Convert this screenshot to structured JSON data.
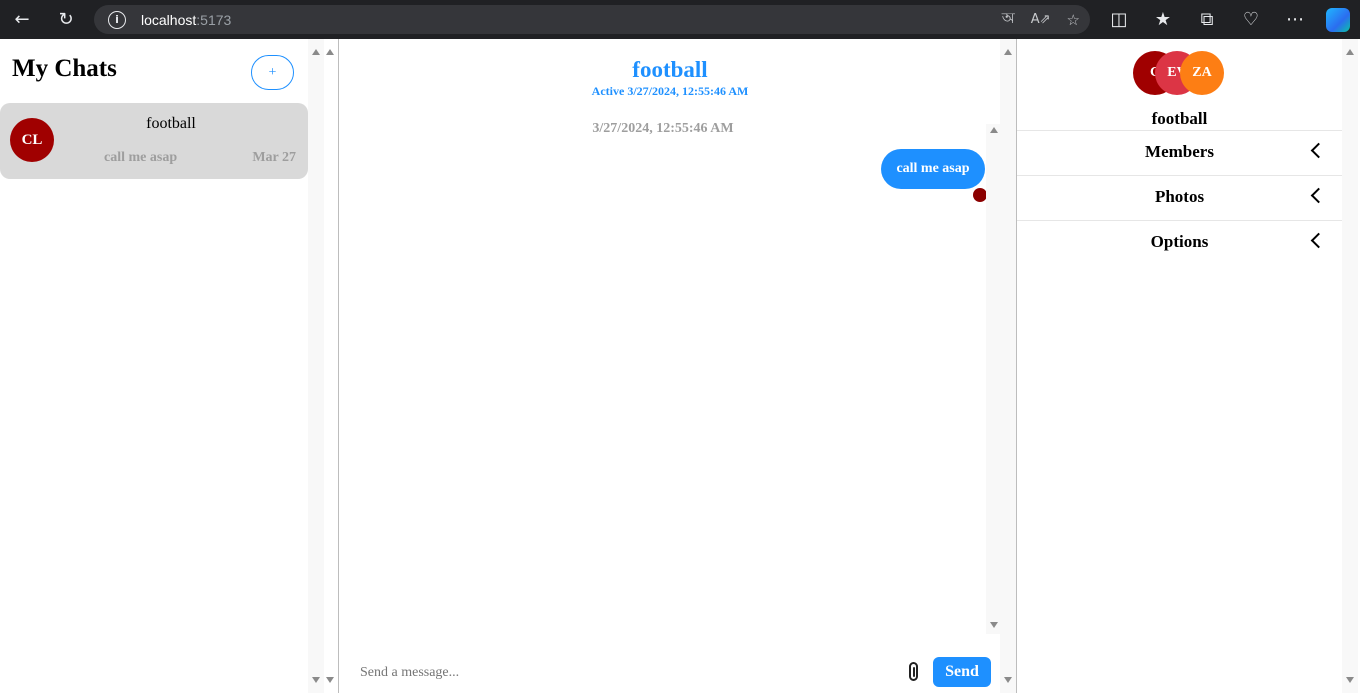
{
  "browser": {
    "url_host": "localhost",
    "url_port": ":5173"
  },
  "sidebar": {
    "title": "My Chats",
    "new_chat_label": "+",
    "chats": [
      {
        "initials": "CL",
        "name": "football",
        "preview": "call me asap",
        "date": "Mar 27",
        "avatar_color": "#a00000"
      }
    ]
  },
  "chat": {
    "title": "football",
    "status": "Active 3/27/2024, 12:55:46 AM",
    "messages": [
      {
        "timestamp": "3/27/2024, 12:55:46 AM",
        "text": "call me asap"
      }
    ],
    "input_placeholder": "Send a message...",
    "send_label": "Send"
  },
  "details": {
    "members": [
      {
        "initials": "C",
        "color": "#a00000"
      },
      {
        "initials": "EV",
        "color": "#dc3545"
      },
      {
        "initials": "ZA",
        "color": "#fd7e14"
      }
    ],
    "group_name": "football",
    "sections": [
      "Members",
      "Photos",
      "Options"
    ]
  },
  "colors": {
    "accent": "#1e90ff",
    "read_dot": "#8b0000",
    "chat_item_bg": "#d9d9d9"
  }
}
